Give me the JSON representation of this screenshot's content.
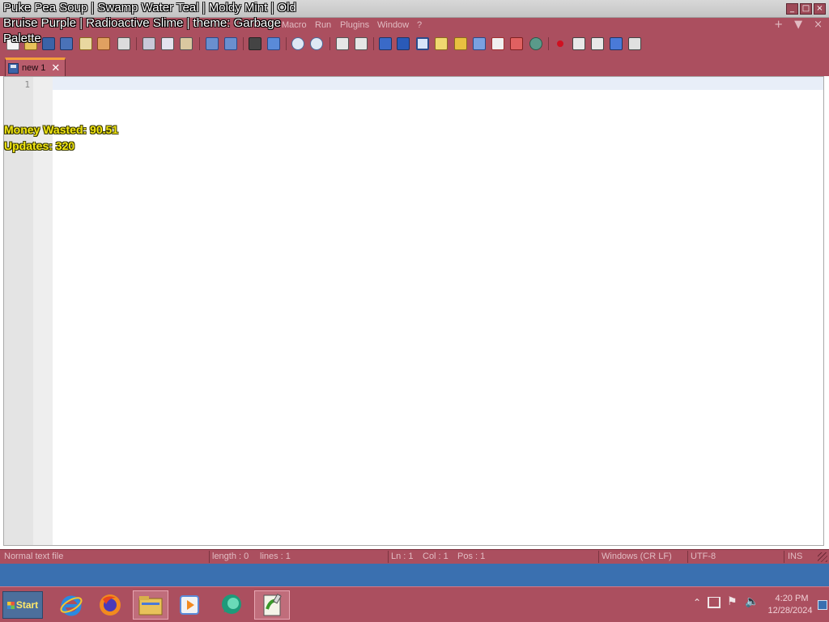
{
  "window": {
    "controls": [
      "_",
      "□",
      "×"
    ]
  },
  "menu": {
    "items": [
      "Macro",
      "Run",
      "Plugins",
      "Window",
      "?"
    ],
    "right_icons": [
      "+",
      "▼",
      "×"
    ]
  },
  "toolbar": {
    "icons": [
      "new-file",
      "open-file",
      "save",
      "save-all",
      "close",
      "close-all",
      "print",
      "cut",
      "copy",
      "paste",
      "undo",
      "redo",
      "find",
      "replace",
      "zoom-in",
      "zoom-out",
      "sync-vertical",
      "sync-horizontal",
      "word-wrap",
      "show-all-chars",
      "indent-guide",
      "udl",
      "doc-map",
      "function-list",
      "folder-as-workspace",
      "doc-list",
      "monitoring",
      "record-macro",
      "stop-macro",
      "playback-macro",
      "run-macro",
      "save-macro"
    ]
  },
  "tab": {
    "label": "new 1",
    "close": "✕"
  },
  "editor": {
    "line_number": "1"
  },
  "status": {
    "file_type": "Normal text file",
    "length": "length : 0",
    "lines": "lines : 1",
    "ln": "Ln : 1",
    "col": "Col : 1",
    "pos": "Pos : 1",
    "eol": "Windows (CR LF)",
    "encoding": "UTF-8",
    "mode": "INS"
  },
  "taskbar": {
    "start_label": "Start",
    "apps": [
      "internet-explorer",
      "firefox",
      "file-explorer",
      "media-player",
      "chat-app",
      "notepad-plus-plus"
    ],
    "clock_time": "4:20 PM",
    "clock_date": "12/28/2024"
  },
  "overlay": {
    "theme_text": "Puke Pea Soup | Swamp Water Teal | Moldy Mint | Old Bruise Purple | Radioactive Slime | theme: Garbage Palette",
    "money_wasted": "Money Wasted: 90.51",
    "updates": "Updates: 320"
  },
  "colors": {
    "chrome": "#ab4f5f",
    "overlay_yellow": "#f2e612",
    "desktop_blue": "#3a70b0"
  }
}
